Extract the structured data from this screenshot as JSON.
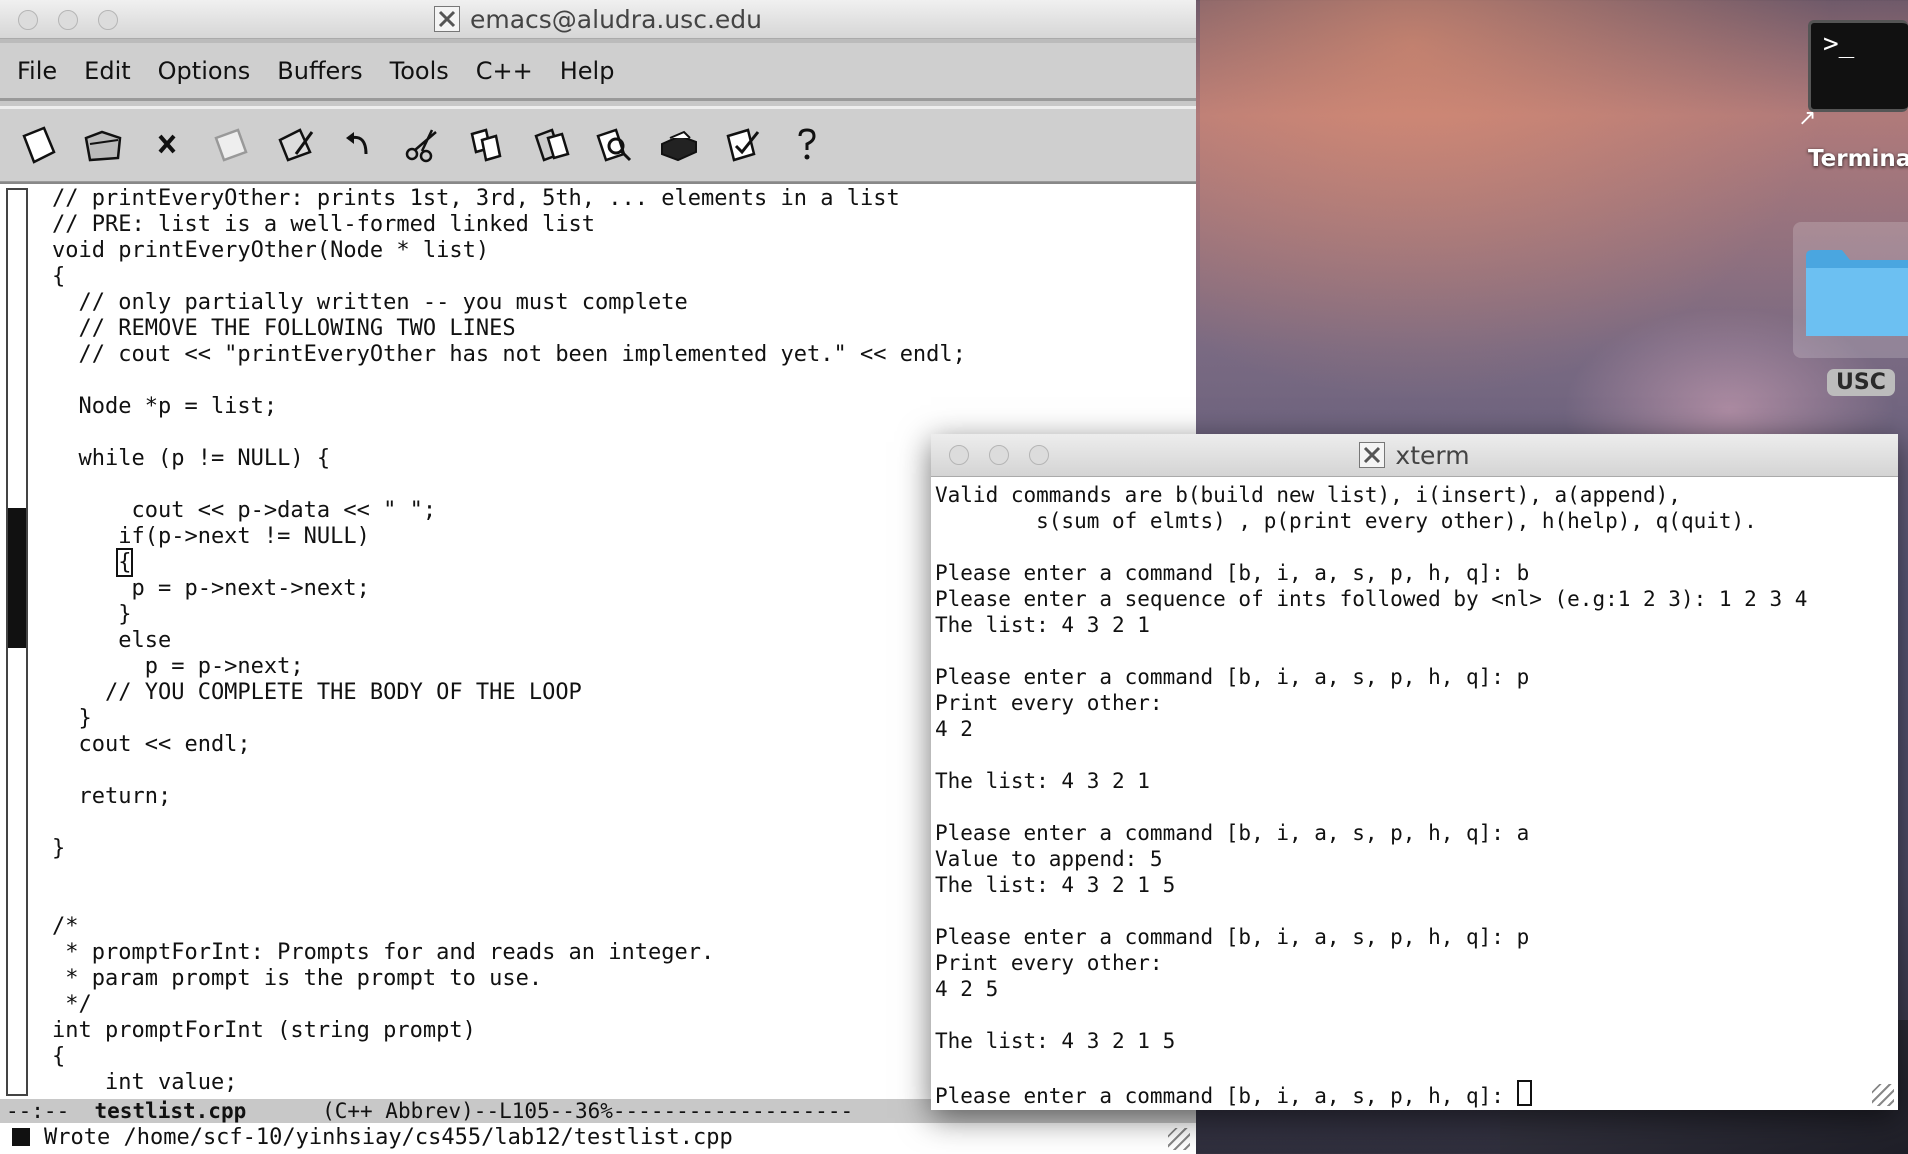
{
  "emacs": {
    "title": "emacs@aludra.usc.edu",
    "menu": [
      "File",
      "Edit",
      "Options",
      "Buffers",
      "Tools",
      "C++",
      "Help"
    ],
    "toolbar": [
      "new-file-icon",
      "open-folder-icon",
      "close-icon",
      "save-icon",
      "save-as-icon",
      "undo-icon",
      "cut-icon",
      "copy-icon",
      "paste-icon",
      "search-icon",
      "print-icon",
      "preferences-icon",
      "help-icon"
    ],
    "code_lines": {
      "l1": "// printEveryOther: prints 1st, 3rd, 5th, ... elements in a list",
      "l2": "// PRE: list is a well-formed linked list",
      "l3": "void printEveryOther(Node * list)",
      "l4": "{",
      "l5": "  // only partially written -- you must complete",
      "l6": "  // REMOVE THE FOLLOWING TWO LINES",
      "l7": "  // cout << \"printEveryOther has not been implemented yet.\" << endl;",
      "l8": "",
      "l9": "  Node *p = list;",
      "l10": "",
      "l11": "  while (p != NULL) {",
      "l12": "",
      "l13": "      cout << p->data << \" \";",
      "l14": "     if(p->next != NULL)",
      "l15a": "     ",
      "l15b": "{",
      "l16": "      p = p->next->next;",
      "l17": "     }",
      "l18": "     else",
      "l19": "       p = p->next;",
      "l20": "    // YOU COMPLETE THE BODY OF THE LOOP",
      "l21": "  }",
      "l22": "  cout << endl;",
      "l23": "",
      "l24": "  return;",
      "l25": "",
      "l26": "}",
      "l27": "",
      "l28": "",
      "l29": "/*",
      "l30": " * promptForInt: Prompts for and reads an integer.",
      "l31": " * param prompt is the prompt to use.",
      "l32": " */",
      "l33": "int promptForInt (string prompt)",
      "l34": "{",
      "l35": "    int value;"
    },
    "modeline": {
      "prefix": "--:--  ",
      "buffer": "testlist.cpp",
      "rest": "      (C++ Abbrev)--L105--36%-------------------"
    },
    "minibuffer": "Wrote /home/scf-10/yinhsiay/cs455/lab12/testlist.cpp"
  },
  "xterm": {
    "title": "xterm",
    "lines": {
      "t1": "Valid commands are b(build new list), i(insert), a(append),",
      "t2": "        s(sum of elmts) , p(print every other), h(help), q(quit).",
      "t3": "",
      "t4": "Please enter a command [b, i, a, s, p, h, q]: b",
      "t5": "Please enter a sequence of ints followed by <nl> (e.g:1 2 3): 1 2 3 4",
      "t6": "The list: 4 3 2 1",
      "t7": "",
      "t8": "Please enter a command [b, i, a, s, p, h, q]: p",
      "t9": "Print every other:",
      "t10": "4 2",
      "t11": "",
      "t12": "The list: 4 3 2 1",
      "t13": "",
      "t14": "Please enter a command [b, i, a, s, p, h, q]: a",
      "t15": "Value to append: 5",
      "t16": "The list: 4 3 2 1 5",
      "t17": "",
      "t18": "Please enter a command [b, i, a, s, p, h, q]: p",
      "t19": "Print every other:",
      "t20": "4 2 5",
      "t21": "",
      "t22": "The list: 4 3 2 1 5",
      "t23": "",
      "t24": "Please enter a command [b, i, a, s, p, h, q]: "
    }
  },
  "desktop": {
    "terminal_prompt": ">_",
    "terminal_label": "Termina",
    "folder_label": "USC",
    "folder_color": "#5ab4ea"
  }
}
